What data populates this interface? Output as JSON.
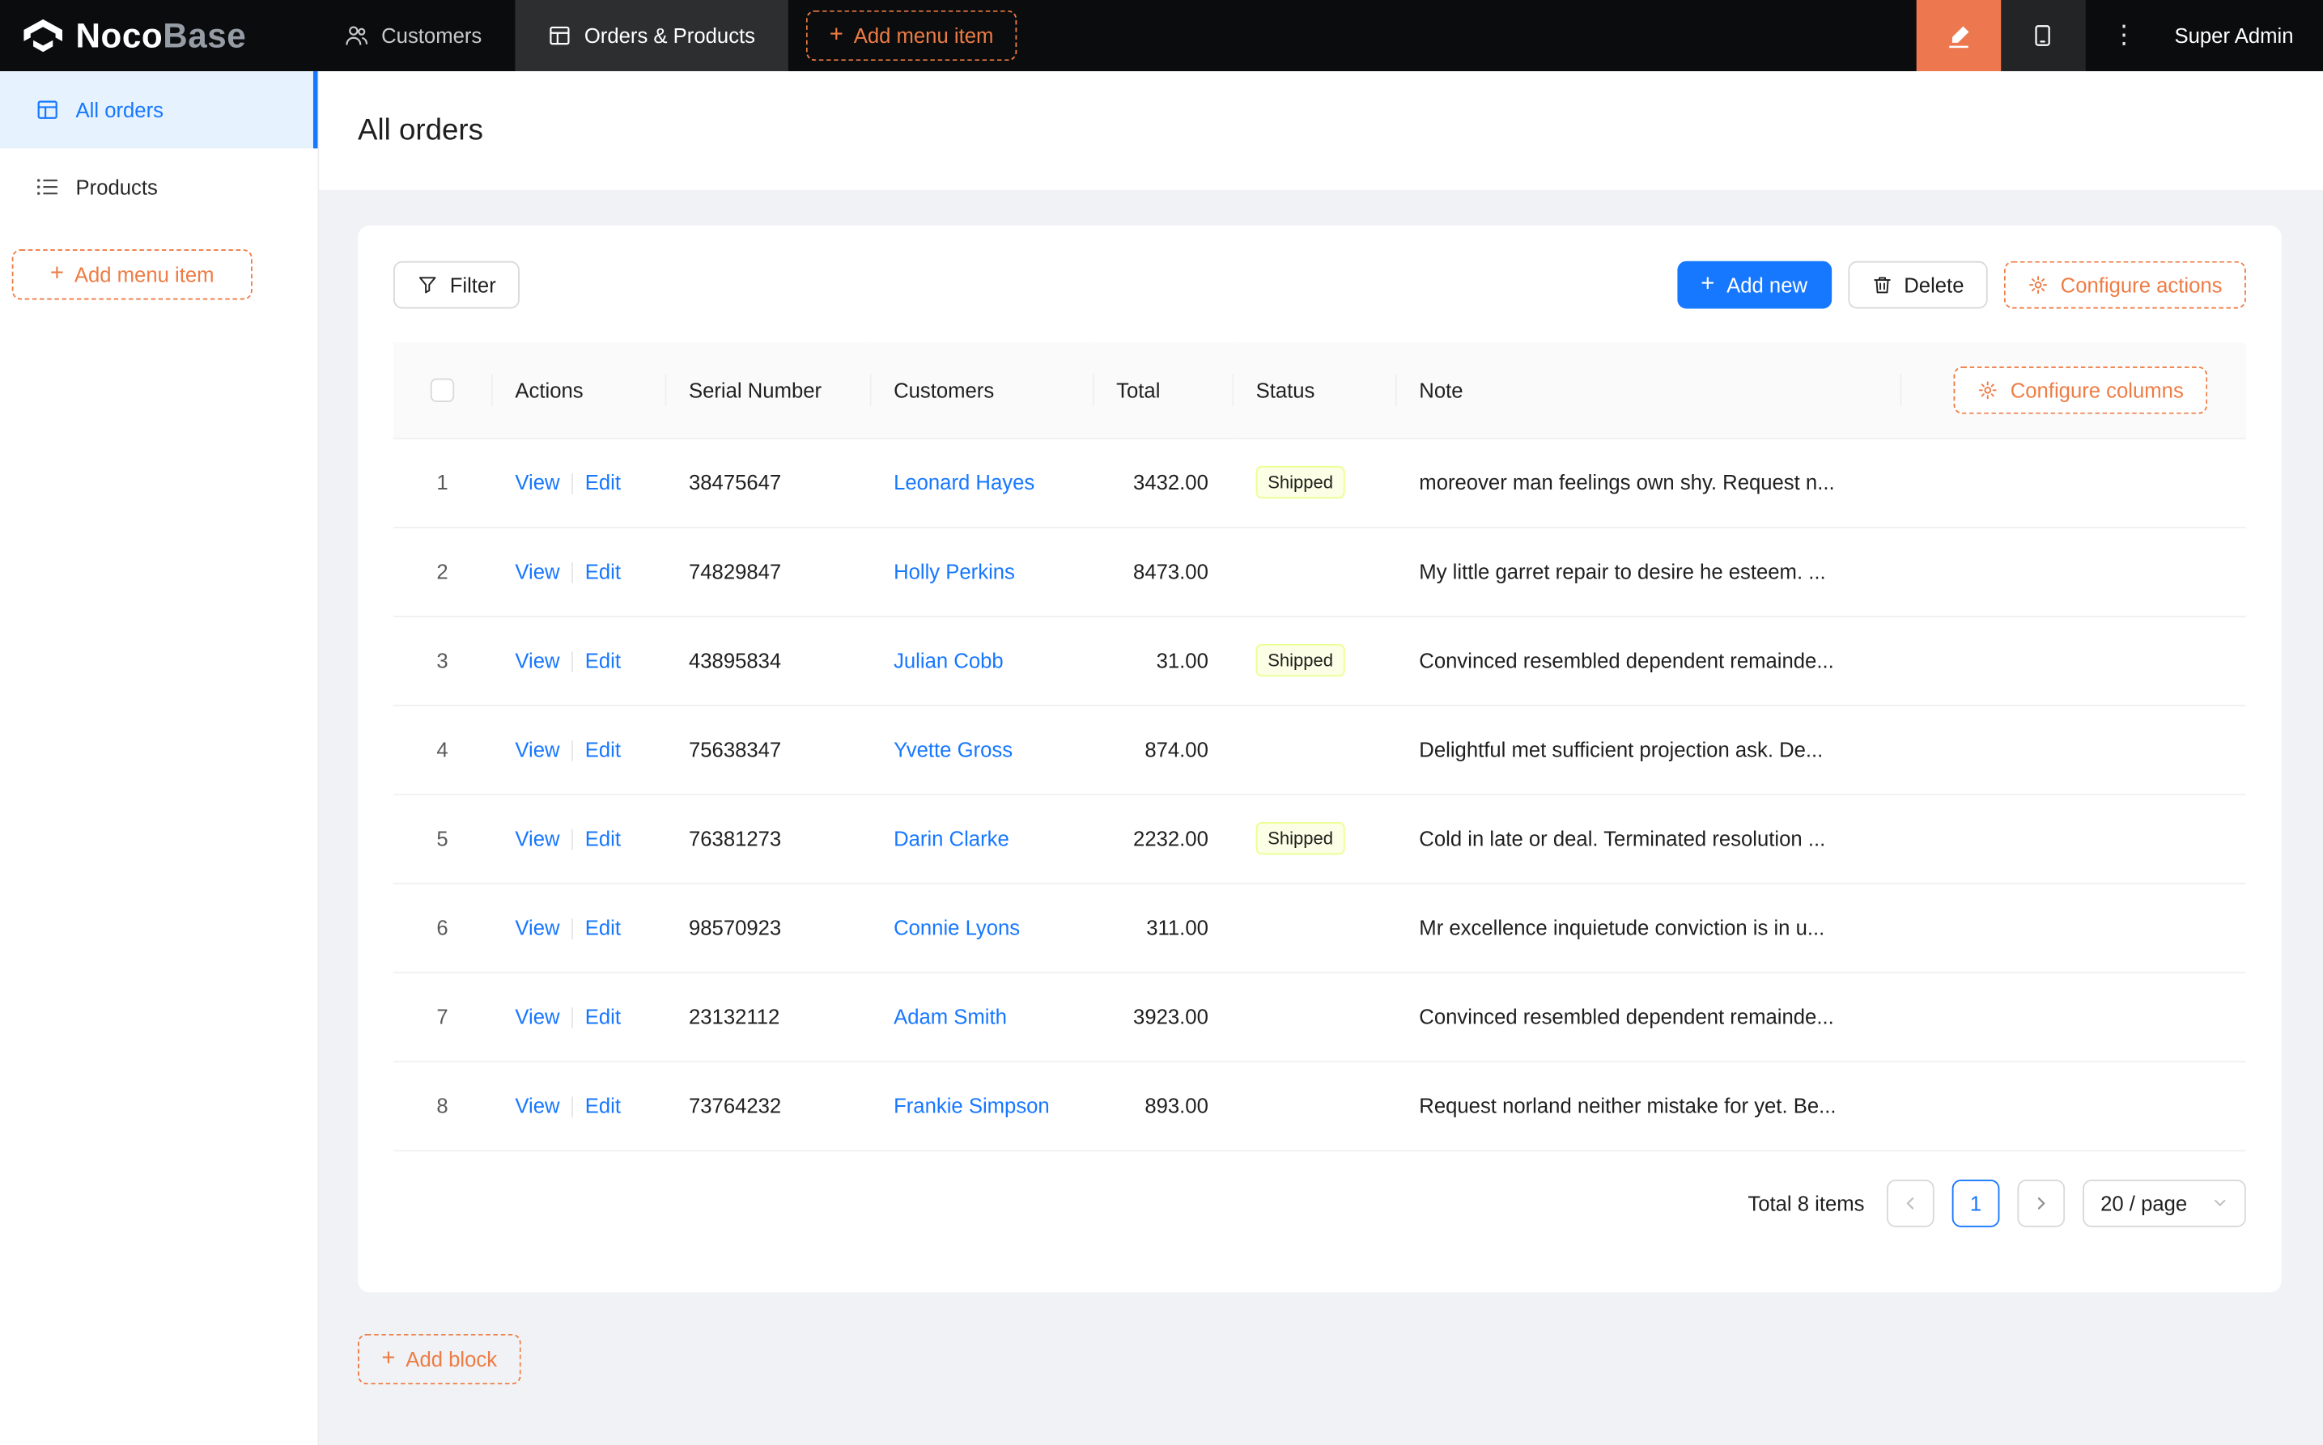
{
  "colors": {
    "primary_blue": "#1677FF",
    "accent_orange": "#EE7C45",
    "designer_button_bg": "#ED7850",
    "header_bg": "#0A0C0E",
    "sidebar_active_bg": "#E6F3FF",
    "content_bg": "#F0F2F5",
    "tag_shipped_bg": "#FCFFE6",
    "tag_shipped_border": "#EAFF8F"
  },
  "icons": {
    "plus": "+",
    "ellipsis": "⋮"
  },
  "header": {
    "brand": {
      "bold": "Noco",
      "light": "Base"
    },
    "nav": [
      {
        "label": "Customers"
      },
      {
        "label": "Orders & Products"
      }
    ],
    "add_menu_item": "Add menu item",
    "user": "Super Admin"
  },
  "sidebar": {
    "items": [
      {
        "label": "All orders"
      },
      {
        "label": "Products"
      }
    ],
    "add_menu_item": "Add menu item"
  },
  "page": {
    "title": "All orders"
  },
  "toolbar": {
    "filter": "Filter",
    "add_new": "Add new",
    "delete": "Delete",
    "configure_actions": "Configure actions"
  },
  "table": {
    "columns": {
      "actions": "Actions",
      "serial": "Serial Number",
      "customers": "Customers",
      "total": "Total",
      "status": "Status",
      "note": "Note"
    },
    "configure_columns": "Configure columns",
    "row_actions": {
      "view": "View",
      "edit": "Edit"
    },
    "rows": [
      {
        "index": "1",
        "serial": "38475647",
        "customer": "Leonard Hayes",
        "total": "3432.00",
        "status": "Shipped",
        "note": "moreover man feelings own shy. Request n..."
      },
      {
        "index": "2",
        "serial": "74829847",
        "customer": "Holly Perkins",
        "total": "8473.00",
        "status": "",
        "note": "My little garret repair to desire he esteem. ..."
      },
      {
        "index": "3",
        "serial": "43895834",
        "customer": "Julian Cobb",
        "total": "31.00",
        "status": "Shipped",
        "note": "Convinced resembled dependent remainde..."
      },
      {
        "index": "4",
        "serial": "75638347",
        "customer": "Yvette Gross",
        "total": "874.00",
        "status": "",
        "note": "Delightful met sufficient projection ask. De..."
      },
      {
        "index": "5",
        "serial": "76381273",
        "customer": "Darin Clarke",
        "total": "2232.00",
        "status": "Shipped",
        "note": "Cold in late or deal. Terminated resolution ..."
      },
      {
        "index": "6",
        "serial": "98570923",
        "customer": "Connie Lyons",
        "total": "311.00",
        "status": "",
        "note": "Mr excellence inquietude conviction is in u..."
      },
      {
        "index": "7",
        "serial": "23132112",
        "customer": "Adam Smith",
        "total": "3923.00",
        "status": "",
        "note": "Convinced resembled dependent remainde..."
      },
      {
        "index": "8",
        "serial": "73764232",
        "customer": "Frankie Simpson",
        "total": "893.00",
        "status": "",
        "note": "Request norland neither mistake for yet. Be..."
      }
    ]
  },
  "pagination": {
    "total": "Total 8 items",
    "current_page": "1",
    "page_size": "20 / page"
  },
  "footer": {
    "add_block": "Add block"
  }
}
